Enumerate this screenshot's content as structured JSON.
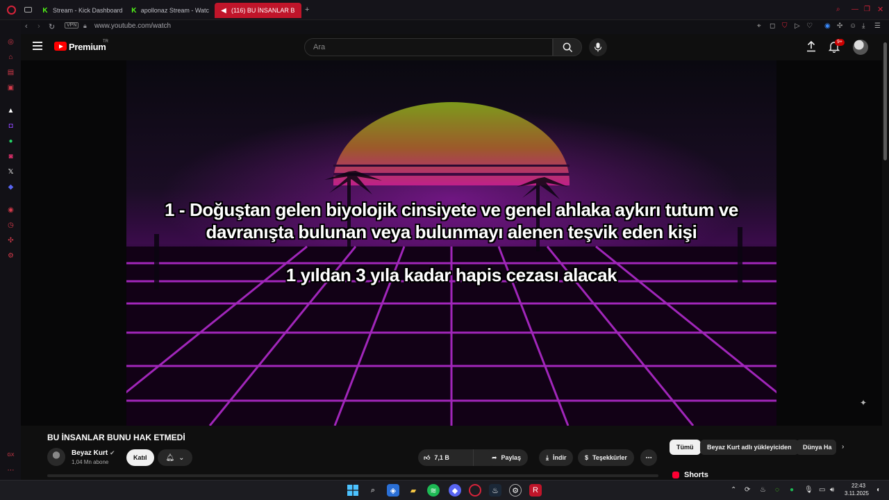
{
  "browser": {
    "tabs": [
      {
        "label": "Stream - Kick Dashboard"
      },
      {
        "label": "apollonaz Stream - Watc"
      },
      {
        "label": "(116) BU İNSANLAR B"
      }
    ],
    "new_tab": "+",
    "vpn_label": "VPN",
    "url": "www.youtube.com/watch"
  },
  "youtube": {
    "logo_text": "Premium",
    "region": "TR",
    "search": {
      "placeholder": "Ara"
    },
    "notifications_badge": "9+"
  },
  "video": {
    "subtitle_line1": "1 - Doğuştan gelen biyolojik cinsiyete ve genel ahlaka aykırı tutum ve",
    "subtitle_line2": "davranışta bulunan veya bulunmayı alenen teşvik eden kişi",
    "subtitle_line3": "1 yıldan 3 yıla kadar hapis cezası alacak",
    "title": "BU İNSANLAR BUNU HAK ETMEDİ"
  },
  "channel": {
    "name": "Beyaz Kurt",
    "subscribers": "1,04 Mn abone",
    "join_label": "Katıl"
  },
  "actions": {
    "likes": "7,1 B",
    "share": "Paylaş",
    "download": "İndir",
    "thanks": "Teşekkürler"
  },
  "sidebar_chips": [
    "Tümü",
    "Beyaz Kurt adlı yükleyiciden",
    "Dünya Ha"
  ],
  "shorts_label": "Shorts",
  "taskbar": {
    "time": "22:43",
    "date": "3.11.2025"
  },
  "colors": {
    "opera_red": "#c0152a",
    "youtube_red": "#ff0000",
    "accent_purple": "#8a1ba8"
  }
}
